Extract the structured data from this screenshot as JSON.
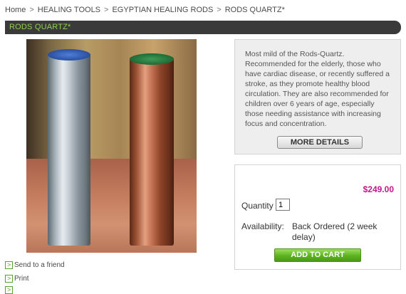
{
  "breadcrumb": {
    "items": [
      "Home",
      "HEALING TOOLS",
      "EGYPTIAN HEALING RODS",
      "RODS QUARTZ*"
    ],
    "separator": ">"
  },
  "product": {
    "title": "RODS QUARTZ*",
    "description": "Most mild of the Rods-Quartz. Recommended for the elderly, those who have cardiac disease, or recently suffered a stroke, as they promote healthy blood circulation. They are also recommended for children over 6 years of age, especially those needing assistance with increasing focus and concentration.",
    "more_details_label": "MORE DETAILS",
    "price": "$249.00",
    "quantity_label": "Quantity :",
    "quantity_value": "1",
    "availability_label": "Availability:",
    "availability_value": "Back Ordered (2 week delay)",
    "add_to_cart_label": "ADD TO CART"
  },
  "links": {
    "send_to_friend": "Send to a friend",
    "print": "Print",
    "arrow_glyph": ">"
  },
  "colors": {
    "title_bar_bg": "#3a3a3a",
    "title_text": "#8fd14f",
    "price": "#c4168a",
    "cart_button": "#5cb21f"
  }
}
